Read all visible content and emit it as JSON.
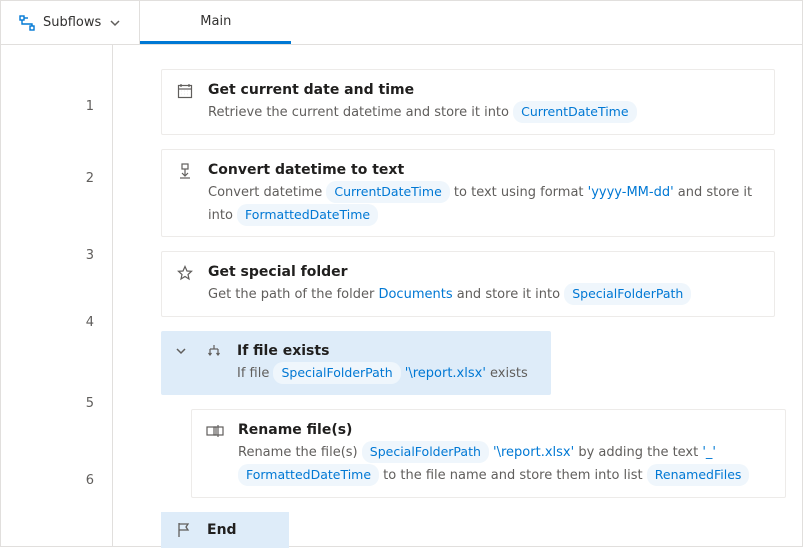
{
  "topbar": {
    "subflows_label": "Subflows",
    "tab_main": "Main"
  },
  "lines": {
    "l1": "1",
    "l2": "2",
    "l3": "3",
    "l4": "4",
    "l5": "5",
    "l6": "6"
  },
  "a1": {
    "title": "Get current date and time",
    "desc_pre": "Retrieve the current datetime and store it into ",
    "var": "CurrentDateTime"
  },
  "a2": {
    "title": "Convert datetime to text",
    "desc1": "Convert datetime ",
    "var_in": "CurrentDateTime",
    "desc2": " to text using format ",
    "fmt": "'yyyy-MM-dd'",
    "desc3": " and store it into ",
    "var_out": "FormattedDateTime"
  },
  "a3": {
    "title": "Get special folder",
    "desc1": "Get the path of the folder ",
    "folder": "Documents",
    "desc2": " and store it into ",
    "var": "SpecialFolderPath"
  },
  "a4": {
    "title": "If file exists",
    "desc1": "If file  ",
    "var": "SpecialFolderPath",
    "path": " '\\report.xlsx'",
    "desc2": " exists"
  },
  "a5": {
    "title": "Rename file(s)",
    "desc1": "Rename the file(s) ",
    "var1": "SpecialFolderPath",
    "path": " '\\report.xlsx'",
    "desc2": " by adding the text ",
    "underscore": "'_'",
    "space": "",
    "var2": "FormattedDateTime",
    "desc3": " to the file name and store them into list ",
    "var3": "RenamedFiles"
  },
  "a6": {
    "title": "End"
  }
}
